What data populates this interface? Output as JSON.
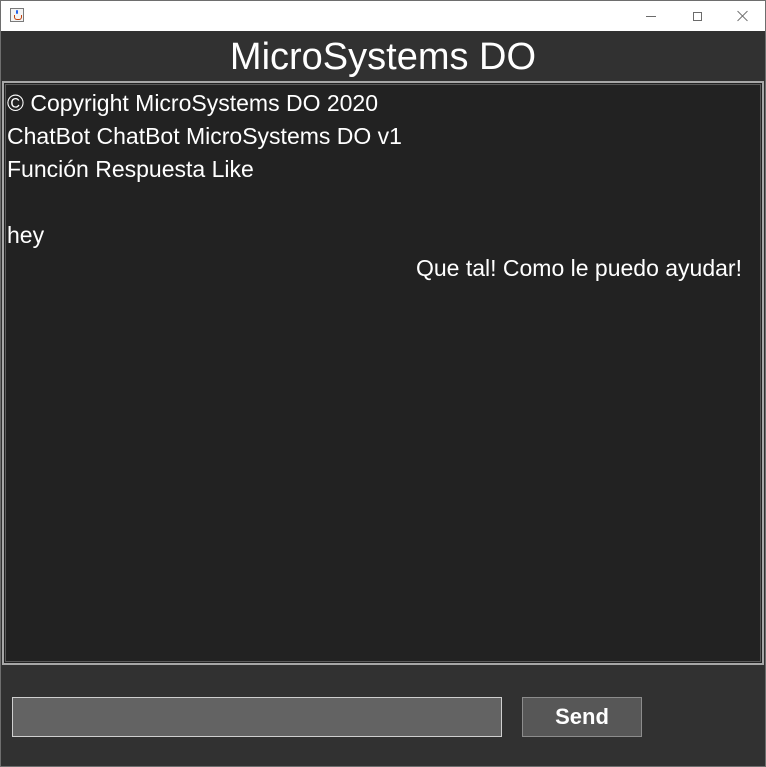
{
  "window": {
    "title": "",
    "icon": "java-cup-icon",
    "controls": {
      "minimize_icon": "minimize-icon",
      "maximize_icon": "maximize-icon",
      "close_icon": "close-icon"
    }
  },
  "header": {
    "title": "MicroSystems DO"
  },
  "chat": {
    "messages": [
      {
        "text": "© Copyright MicroSystems DO 2020",
        "align": "left"
      },
      {
        "text": "ChatBot ChatBot MicroSystems DO v1",
        "align": "left"
      },
      {
        "text": "Función Respuesta Like",
        "align": "left"
      },
      {
        "text": "hey",
        "align": "left",
        "sender": "user"
      },
      {
        "text": "Que tal! Como le puedo ayudar!",
        "align": "right",
        "sender": "bot"
      }
    ]
  },
  "input": {
    "value": "",
    "placeholder": ""
  },
  "send_button": {
    "label": "Send"
  },
  "colors": {
    "window_bg": "#313131",
    "chat_bg": "#222222",
    "text": "#ffffff",
    "input_bg": "#636363",
    "button_bg": "#575757"
  }
}
